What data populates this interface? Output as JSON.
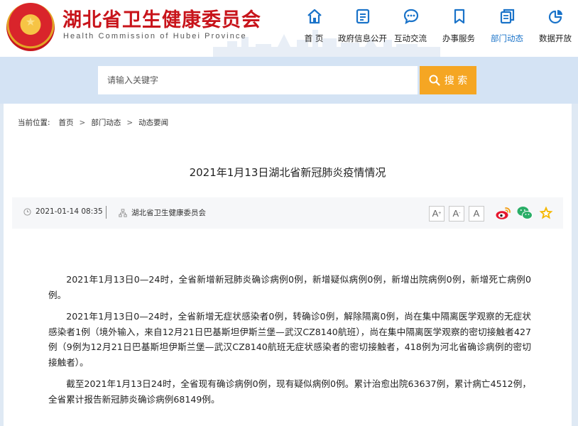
{
  "site": {
    "title": "湖北省卫生健康委员会",
    "subtitle": "Health Commission of Hubei Province",
    "brand_color": "#c8141b"
  },
  "nav": {
    "items": [
      {
        "label": "首 页",
        "icon": "home-icon"
      },
      {
        "label": "政府信息公开",
        "icon": "document-icon"
      },
      {
        "label": "互动交流",
        "icon": "chat-icon"
      },
      {
        "label": "办事服务",
        "icon": "bookmark-icon"
      },
      {
        "label": "部门动态",
        "icon": "files-icon",
        "active": true
      },
      {
        "label": "数据开放",
        "icon": "pie-chart-icon"
      }
    ],
    "active_color": "#1a73c9"
  },
  "search": {
    "placeholder": "请输入关键字",
    "button_label": "搜 索",
    "button_color": "#f5a623"
  },
  "breadcrumb": {
    "prefix": "当前位置:",
    "items": [
      "首页",
      "部门动态",
      "动态要闻"
    ],
    "separator": ">"
  },
  "article": {
    "title": "2021年1月13日湖北省新冠肺炎疫情情况",
    "date": "2021-01-14 08:35",
    "source": "湖北省卫生健康委员会",
    "paragraphs": [
      "2021年1月13日0—24时，全省新增新冠肺炎确诊病例0例，新增疑似病例0例，新增出院病例0例，新增死亡病例0例。",
      "2021年1月13日0—24时，全省新增无症状感染者0例，转确诊0例，解除隔离0例，尚在集中隔离医学观察的无症状感染者1例（境外输入，来自12月21日巴基斯坦伊斯兰堡—武汉CZ8140航班），尚在集中隔离医学观察的密切接触者427例（9例为12月21日巴基斯坦伊斯兰堡—武汉CZ8140航班无症状感染者的密切接触者，418例为河北省确诊病例的密切接触者）。",
      "截至2021年1月13日24时，全省现有确诊病例0例，现有疑似病例0例。累计治愈出院63637例，累计病亡4512例，全省累计报告新冠肺炎确诊病例68149例。"
    ]
  },
  "tools": {
    "font_large": "A",
    "font_medium": "A",
    "font_small": "A",
    "share_icons": [
      "weibo-icon",
      "wechat-icon",
      "favorite-star-icon"
    ]
  }
}
